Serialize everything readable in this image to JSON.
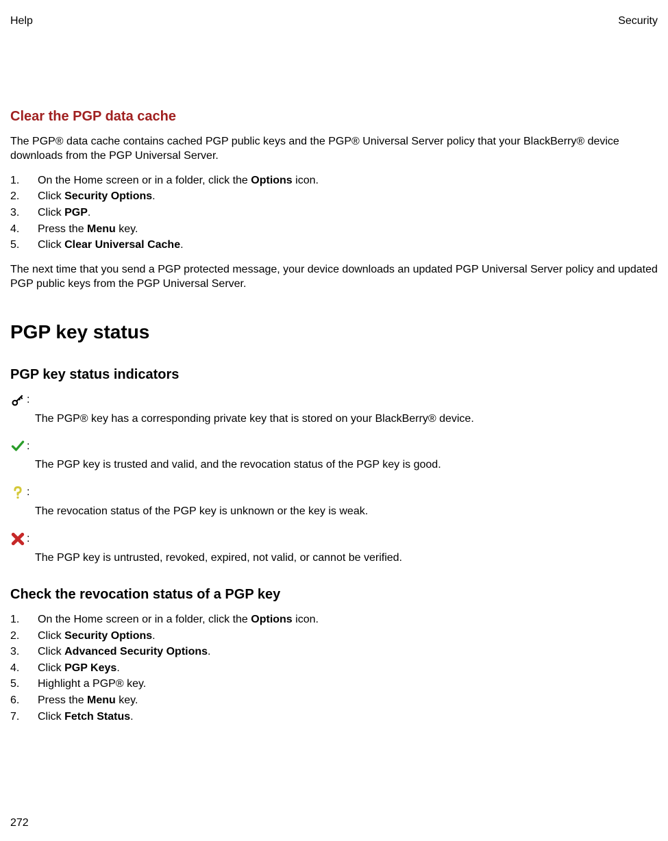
{
  "header": {
    "left": "Help",
    "right": "Security"
  },
  "section1": {
    "title": "Clear the PGP data cache",
    "intro": "The PGP® data cache contains cached PGP public keys and the PGP® Universal Server policy that your BlackBerry® device downloads from the PGP Universal Server.",
    "steps": [
      {
        "num": "1.",
        "pre": "On the Home screen or in a folder, click the ",
        "bold": "Options",
        "post": " icon."
      },
      {
        "num": "2.",
        "pre": "Click ",
        "bold": "Security Options",
        "post": "."
      },
      {
        "num": "3.",
        "pre": "Click ",
        "bold": "PGP",
        "post": "."
      },
      {
        "num": "4.",
        "pre": "Press the ",
        "bold": "Menu",
        "post": " key."
      },
      {
        "num": "5.",
        "pre": "Click ",
        "bold": "Clear Universal Cache",
        "post": "."
      }
    ],
    "outro": "The next time that you send a PGP protected message, your device downloads an updated PGP Universal Server policy and updated PGP public keys from the PGP Universal Server."
  },
  "main_heading": "PGP key status",
  "section2": {
    "title": "PGP key status indicators",
    "indicators": [
      {
        "desc": "The PGP® key has a corresponding private key that is stored on your BlackBerry® device."
      },
      {
        "desc": "The PGP key is trusted and valid, and the revocation status of the PGP key is good."
      },
      {
        "desc": "The revocation status of the PGP key is unknown or the key is weak."
      },
      {
        "desc": "The PGP key is untrusted, revoked, expired, not valid, or cannot be verified."
      }
    ]
  },
  "section3": {
    "title": "Check the revocation status of a PGP key",
    "steps": [
      {
        "num": "1.",
        "pre": "On the Home screen or in a folder, click the ",
        "bold": "Options",
        "post": " icon."
      },
      {
        "num": "2.",
        "pre": "Click ",
        "bold": "Security Options",
        "post": "."
      },
      {
        "num": "3.",
        "pre": "Click ",
        "bold": "Advanced Security Options",
        "post": "."
      },
      {
        "num": "4.",
        "pre": "Click ",
        "bold": "PGP Keys",
        "post": "."
      },
      {
        "num": "5.",
        "pre": "Highlight a PGP® key.",
        "bold": "",
        "post": ""
      },
      {
        "num": "6.",
        "pre": "Press the ",
        "bold": "Menu",
        "post": " key."
      },
      {
        "num": "7.",
        "pre": "Click ",
        "bold": "Fetch Status",
        "post": "."
      }
    ]
  },
  "page_number": "272"
}
